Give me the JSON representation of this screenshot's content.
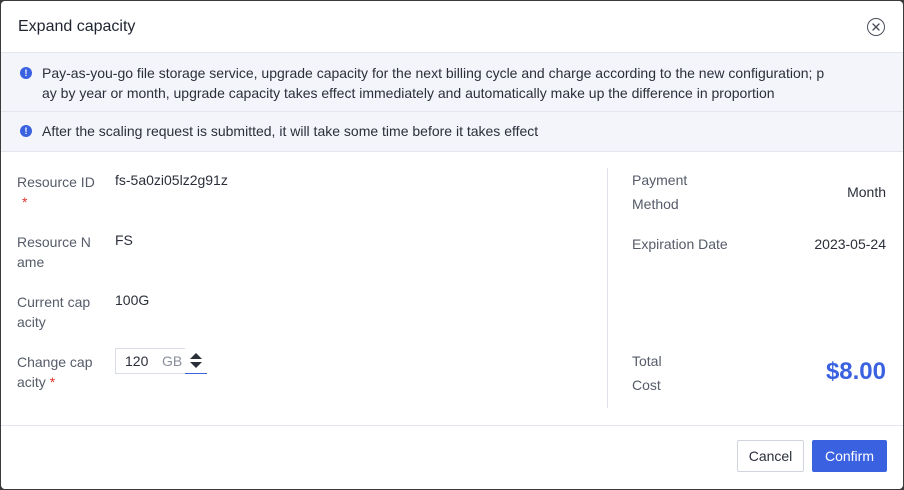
{
  "dialog": {
    "title": "Expand capacity",
    "close_icon": "close-circle-icon"
  },
  "notices": [
    {
      "icon": "info-icon",
      "text": "Pay-as-you-go file storage service, upgrade capacity for the next billing cycle and charge according to the new configuration; p",
      "text2": "ay by year or month, upgrade capacity takes effect immediately and automatically make up the difference in proportion"
    },
    {
      "icon": "info-icon",
      "text": "After the scaling request is submitted, it will take some time before it takes effect"
    }
  ],
  "form": {
    "resource_id": {
      "label": "Resource ID",
      "required_mark": "*",
      "value": "fs-5a0zi05lz2g91z"
    },
    "resource_name": {
      "label_line1": "Resource N",
      "label_line2": "ame",
      "value": "FS"
    },
    "current_capacity": {
      "label_line1": "Current cap",
      "label_line2": "acity",
      "value": "100G"
    },
    "change_capacity": {
      "label_line1": "Change cap",
      "label_line2": "acity",
      "required_mark": "*",
      "value": "120",
      "unit": "GB"
    }
  },
  "summary": {
    "payment_method": {
      "label_line1": "Payment",
      "label_line2": "Method",
      "value": "Month"
    },
    "expiration_date": {
      "label": "Expiration Date",
      "value": "2023-05-24"
    },
    "total_cost": {
      "label_line1": "Total",
      "label_line2": "Cost",
      "value": "$8.00"
    }
  },
  "footer": {
    "cancel_label": "Cancel",
    "confirm_label": "Confirm"
  },
  "colors": {
    "accent": "#3a62e0",
    "required": "#e5332a",
    "notice_bg": "#f4f5fb"
  }
}
